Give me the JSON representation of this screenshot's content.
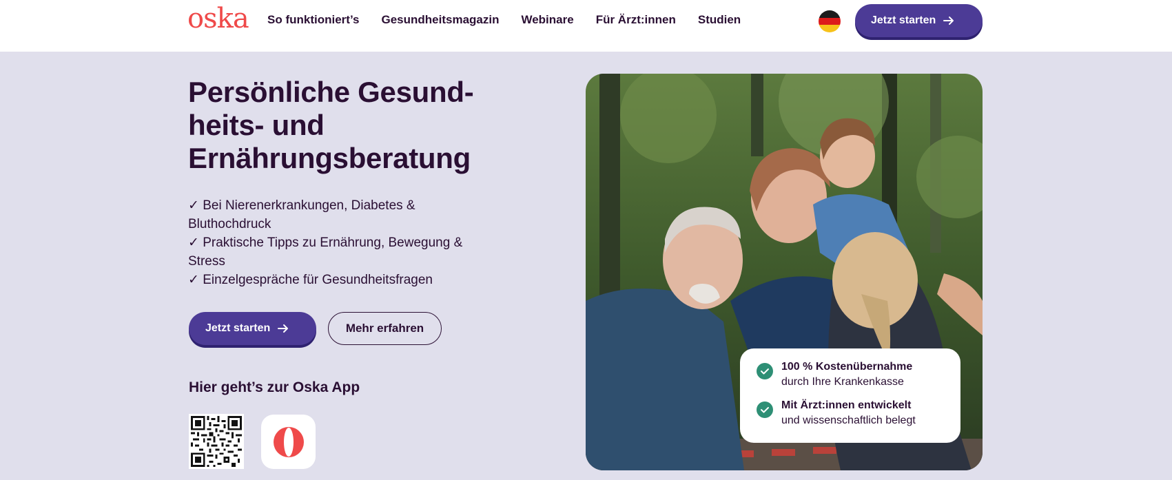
{
  "header": {
    "logo": "oska",
    "nav": [
      "So funktioniert’s",
      "Gesundheitsmagazin",
      "Webinare",
      "Für Ärzt:innen",
      "Studien"
    ],
    "language_icon": "germany-flag-icon",
    "cta_label": "Jetzt starten"
  },
  "hero": {
    "title": "Persönliche Gesund-heits- und Ernährungsberatung",
    "benefits": [
      "✓ Bei Nierenerkrankungen, Diabetes & Bluthochdruck",
      "✓ Praktische Tipps zu Ernährung, Bewegung & Stress",
      "✓ Einzelgespräche für Gesundheitsfragen"
    ],
    "primary_button": "Jetzt starten",
    "secondary_button": "Mehr erfahren"
  },
  "app": {
    "heading": "Hier geht’s zur Oska App",
    "qr_icon": "qr-code-icon",
    "app_icon": "oska-app-icon"
  },
  "badges": [
    {
      "strong": "100 % Kostenübernahme",
      "sub": "durch Ihre Krankenkasse"
    },
    {
      "strong": "Mit Ärzt:innen entwickelt",
      "sub": "und wissenschaftlich belegt"
    }
  ],
  "colors": {
    "background": "#e0dfec",
    "brand_red": "#ef4a4a",
    "primary_button": "#4c3b96",
    "text": "#2a0f33",
    "check": "#2e8f75"
  }
}
